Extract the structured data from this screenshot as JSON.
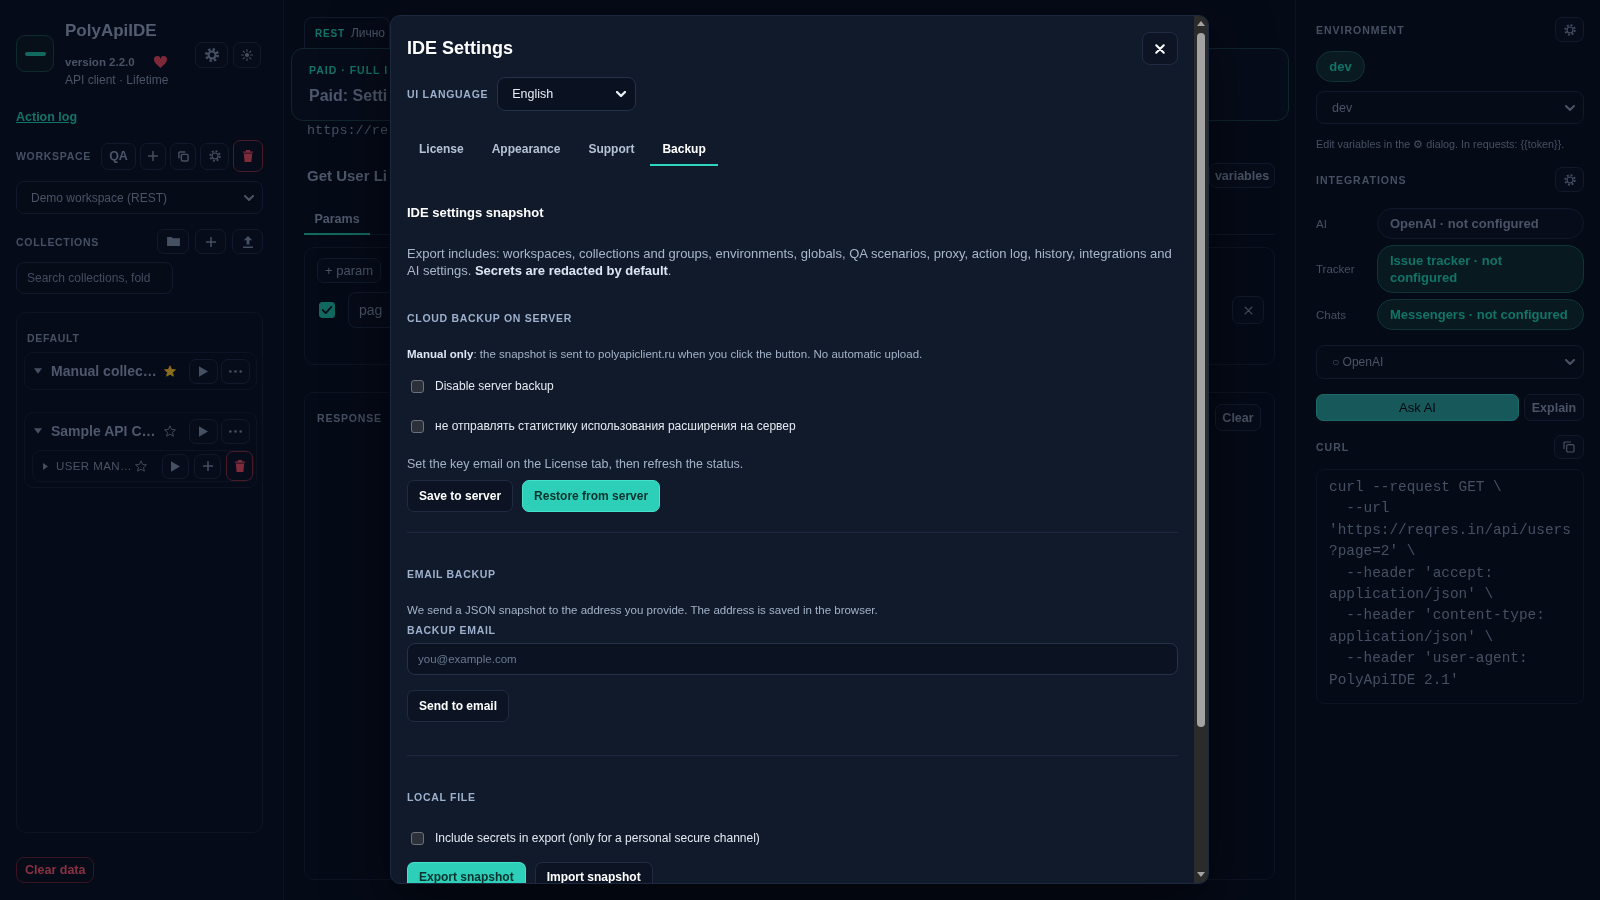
{
  "sidebar": {
    "app_name": "PolyApiIDE",
    "version": "version 2.2.0",
    "plan": "API client · Lifetime",
    "action_log_link": "Action log",
    "workspace": {
      "label": "WORKSPACE",
      "qa_button": "QA",
      "selected": "Demo workspace (REST)"
    },
    "collections": {
      "label": "COLLECTIONS",
      "search_placeholder": "Search collections, fold",
      "group_label": "DEFAULT",
      "items": [
        {
          "kind": "collection",
          "name": "Manual collec…",
          "expanded": true,
          "starred": true
        },
        {
          "kind": "collection",
          "name": "Sample API C…",
          "expanded": true,
          "starred": false,
          "children": [
            {
              "kind": "folder",
              "name": "USER MAN…",
              "expanded": false,
              "starred": false
            }
          ]
        }
      ]
    },
    "clear_button": "Clear data"
  },
  "request": {
    "tab": {
      "protocol": "REST",
      "title": "Лично"
    },
    "plan_banner": {
      "tag": "PAID · FULL I",
      "title": "Paid: Setti"
    },
    "url": "https://re",
    "name": "Get User Li",
    "variables_button": "variables",
    "tabs": [
      {
        "label": "Params",
        "selected": true
      }
    ],
    "params": {
      "add_button": "+ param",
      "rows": [
        {
          "enabled": true,
          "key": "pag"
        }
      ]
    },
    "response": {
      "label": "RESPONSE",
      "clear_button": "Clear"
    }
  },
  "right_panel": {
    "environment": {
      "label": "ENVIRONMENT",
      "chip": "dev",
      "selected": "dev",
      "hint": "Edit variables in the ⚙ dialog. In requests: {{token}}."
    },
    "integrations": {
      "label": "INTEGRATIONS",
      "rows": [
        {
          "name": "AI",
          "status": "OpenAI · not configured",
          "highlighted": false
        },
        {
          "name": "Tracker",
          "status": "Issue tracker · not configured",
          "highlighted": true
        },
        {
          "name": "Chats",
          "status": "Messengers · not configured",
          "highlighted": true
        }
      ]
    },
    "ai": {
      "provider": "○ OpenAI",
      "ask_button": "Ask AI",
      "explain_button": "Explain"
    },
    "curl": {
      "label": "CURL",
      "lines": [
        "curl --request GET \\",
        "  --url",
        "'https://reqres.in/api/users",
        "?page=2' \\",
        "  --header 'accept:",
        "application/json' \\",
        "  --header 'content-type:",
        "application/json' \\",
        "  --header 'user-agent:",
        "PolyApiIDE 2.1'"
      ]
    }
  },
  "settings_dialog": {
    "title": "IDE Settings",
    "language": {
      "label": "UI LANGUAGE",
      "value": "English"
    },
    "tabs": [
      {
        "label": "License",
        "selected": false
      },
      {
        "label": "Appearance",
        "selected": false
      },
      {
        "label": "Support",
        "selected": false
      },
      {
        "label": "Backup",
        "selected": true
      }
    ],
    "snapshot": {
      "heading": "IDE settings snapshot",
      "description": "Export includes: workspaces, collections and groups, environments, globals, QA scenarios, proxy, action log, history, integrations and AI settings. **Secrets are redacted by default**."
    },
    "sections": [
      {
        "heading": "CLOUD BACKUP ON SERVER",
        "note": "**Manual only**: the snapshot is sent to polyapiclient.ru when you click the button. No automatic upload.",
        "options": [
          {
            "label": "Disable server backup",
            "checked": false
          },
          {
            "label": "не отправлять статистику использования расширения на сервер",
            "checked": false
          }
        ],
        "hint": "Set the key email on the License tab, then refresh the status.",
        "buttons": [
          {
            "label": "Save to server",
            "kind": "secondary"
          },
          {
            "label": "Restore from server",
            "kind": "primary"
          }
        ]
      },
      {
        "heading": "EMAIL BACKUP",
        "note": "We send a JSON snapshot to the address you provide. The address is saved in the browser.",
        "field": {
          "label": "BACKUP EMAIL",
          "placeholder": "you@example.com"
        },
        "buttons": [
          {
            "label": "Send to email",
            "kind": "secondary"
          }
        ]
      },
      {
        "heading": "LOCAL FILE",
        "options": [
          {
            "label": "Include secrets in export (only for a personal secure channel)",
            "checked": false
          }
        ],
        "buttons": [
          {
            "label": "Export snapshot",
            "kind": "primary"
          },
          {
            "label": "Import snapshot",
            "kind": "secondary"
          }
        ]
      }
    ]
  }
}
